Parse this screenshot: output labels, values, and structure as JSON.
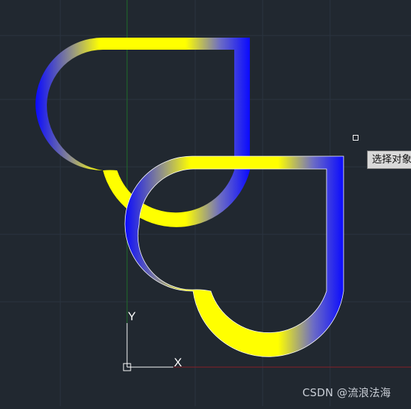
{
  "app": {
    "name": "CAD drawing viewport"
  },
  "colors": {
    "background": "#212830",
    "grid": "#2b3440",
    "axis_x": "#8a1f28",
    "axis_y": "#1f6f2a",
    "fill_blue": "#0a0aff",
    "fill_yellow": "#ffff00",
    "edge": "#ffffff"
  },
  "cursor": {
    "tooltip": "选择对象"
  },
  "ucs": {
    "x_label": "X",
    "y_label": "Y"
  },
  "watermark": "CSDN @流浪法海"
}
